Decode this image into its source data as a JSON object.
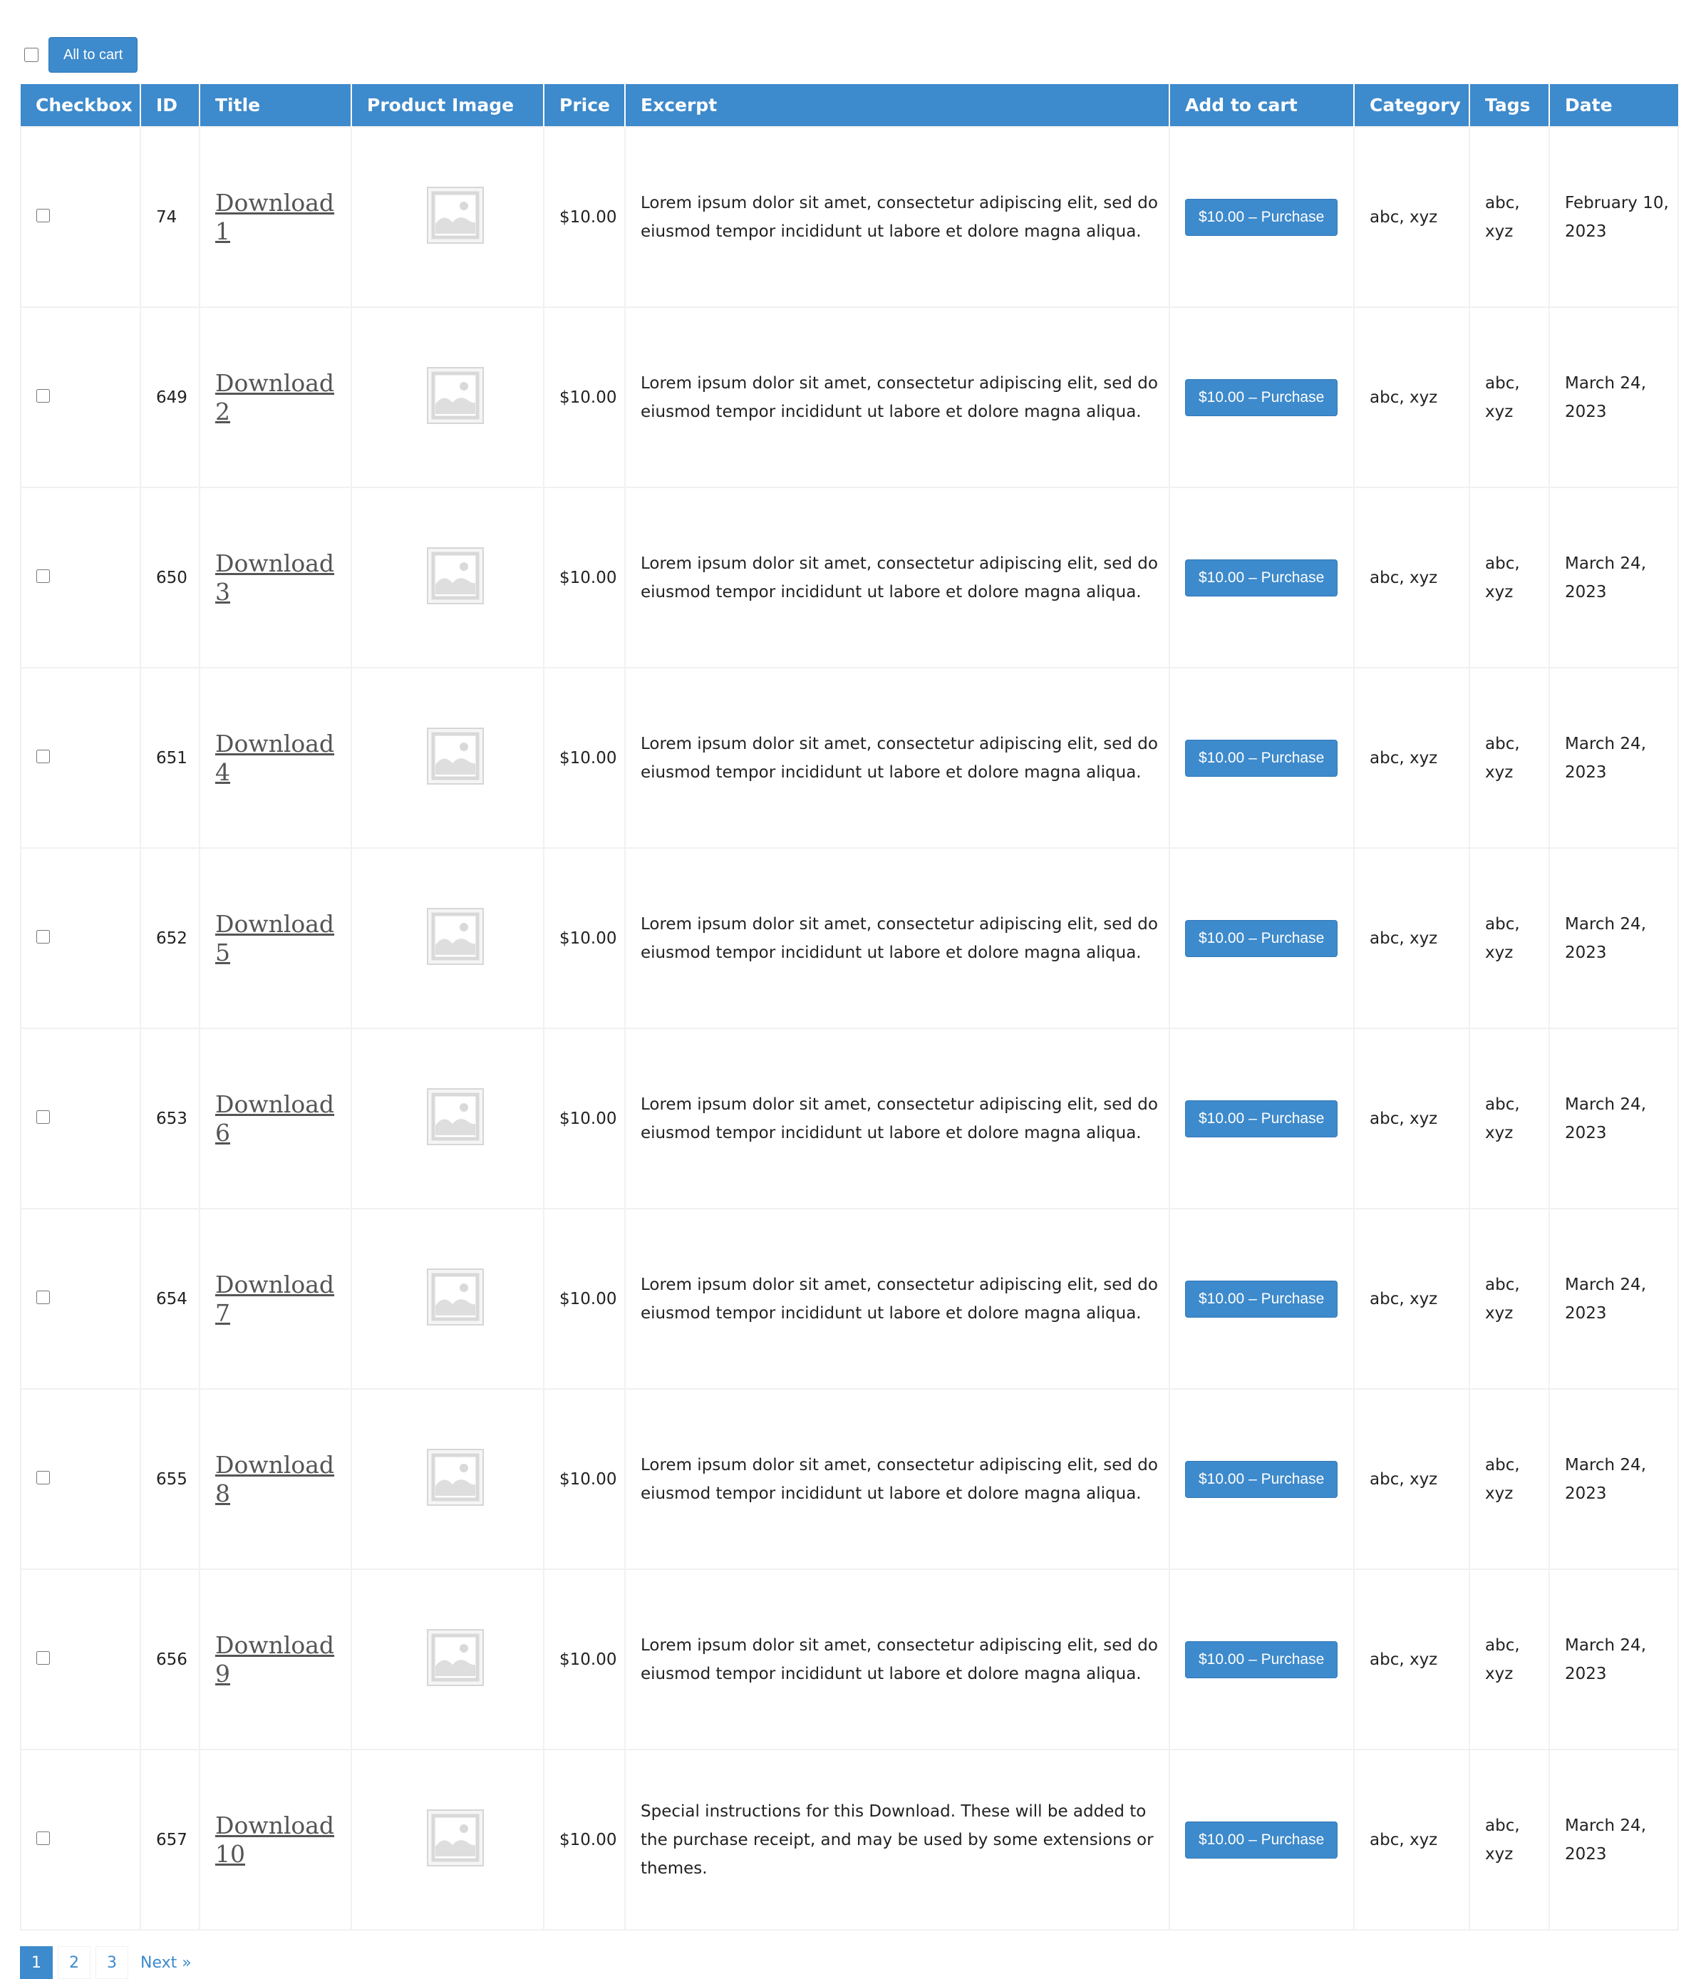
{
  "toolbar": {
    "all_to_cart_label": "All to cart"
  },
  "table": {
    "headers": [
      "Checkbox",
      "ID",
      "Title",
      "Product Image",
      "Price",
      "Excerpt",
      "Add to cart",
      "Category",
      "Tags",
      "Date"
    ],
    "rows": [
      {
        "id": "74",
        "title": "Download 1",
        "price": "$10.00",
        "excerpt": "Lorem ipsum dolor sit amet, consectetur adipiscing elit, sed do eiusmod tempor incididunt ut labore et dolore magna aliqua.",
        "cart_label": "$10.00 – Purchase",
        "category": "abc, xyz",
        "tags": "abc, xyz",
        "date": "February 10, 2023"
      },
      {
        "id": "649",
        "title": "Download 2",
        "price": "$10.00",
        "excerpt": "Lorem ipsum dolor sit amet, consectetur adipiscing elit, sed do eiusmod tempor incididunt ut labore et dolore magna aliqua.",
        "cart_label": "$10.00 – Purchase",
        "category": "abc, xyz",
        "tags": "abc, xyz",
        "date": "March 24, 2023"
      },
      {
        "id": "650",
        "title": "Download 3",
        "price": "$10.00",
        "excerpt": "Lorem ipsum dolor sit amet, consectetur adipiscing elit, sed do eiusmod tempor incididunt ut labore et dolore magna aliqua.",
        "cart_label": "$10.00 – Purchase",
        "category": "abc, xyz",
        "tags": "abc, xyz",
        "date": "March 24, 2023"
      },
      {
        "id": "651",
        "title": "Download 4",
        "price": "$10.00",
        "excerpt": "Lorem ipsum dolor sit amet, consectetur adipiscing elit, sed do eiusmod tempor incididunt ut labore et dolore magna aliqua.",
        "cart_label": "$10.00 – Purchase",
        "category": "abc, xyz",
        "tags": "abc, xyz",
        "date": "March 24, 2023"
      },
      {
        "id": "652",
        "title": "Download 5",
        "price": "$10.00",
        "excerpt": "Lorem ipsum dolor sit amet, consectetur adipiscing elit, sed do eiusmod tempor incididunt ut labore et dolore magna aliqua.",
        "cart_label": "$10.00 – Purchase",
        "category": "abc, xyz",
        "tags": "abc, xyz",
        "date": "March 24, 2023"
      },
      {
        "id": "653",
        "title": "Download 6",
        "price": "$10.00",
        "excerpt": "Lorem ipsum dolor sit amet, consectetur adipiscing elit, sed do eiusmod tempor incididunt ut labore et dolore magna aliqua.",
        "cart_label": "$10.00 – Purchase",
        "category": "abc, xyz",
        "tags": "abc, xyz",
        "date": "March 24, 2023"
      },
      {
        "id": "654",
        "title": "Download 7",
        "price": "$10.00",
        "excerpt": "Lorem ipsum dolor sit amet, consectetur adipiscing elit, sed do eiusmod tempor incididunt ut labore et dolore magna aliqua.",
        "cart_label": "$10.00 – Purchase",
        "category": "abc, xyz",
        "tags": "abc, xyz",
        "date": "March 24, 2023"
      },
      {
        "id": "655",
        "title": "Download 8",
        "price": "$10.00",
        "excerpt": "Lorem ipsum dolor sit amet, consectetur adipiscing elit, sed do eiusmod tempor incididunt ut labore et dolore magna aliqua.",
        "cart_label": "$10.00 – Purchase",
        "category": "abc, xyz",
        "tags": "abc, xyz",
        "date": "March 24, 2023"
      },
      {
        "id": "656",
        "title": "Download 9",
        "price": "$10.00",
        "excerpt": "Lorem ipsum dolor sit amet, consectetur adipiscing elit, sed do eiusmod tempor incididunt ut labore et dolore magna aliqua.",
        "cart_label": "$10.00 – Purchase",
        "category": "abc, xyz",
        "tags": "abc, xyz",
        "date": "March 24, 2023"
      },
      {
        "id": "657",
        "title": "Download 10",
        "price": "$10.00",
        "excerpt": "Special instructions for this Download. These will be added to the purchase receipt, and may be used by some extensions or themes.",
        "cart_label": "$10.00 – Purchase",
        "category": "abc, xyz",
        "tags": "abc, xyz",
        "date": "March 24, 2023"
      }
    ],
    "image_icon": "image-placeholder-icon"
  },
  "pagination": {
    "pages": [
      "1",
      "2",
      "3"
    ],
    "current": "1",
    "next_label": "Next »"
  },
  "colors": {
    "accent": "#3d8acc",
    "row_border": "#f1f1f1",
    "link": "#555555"
  }
}
